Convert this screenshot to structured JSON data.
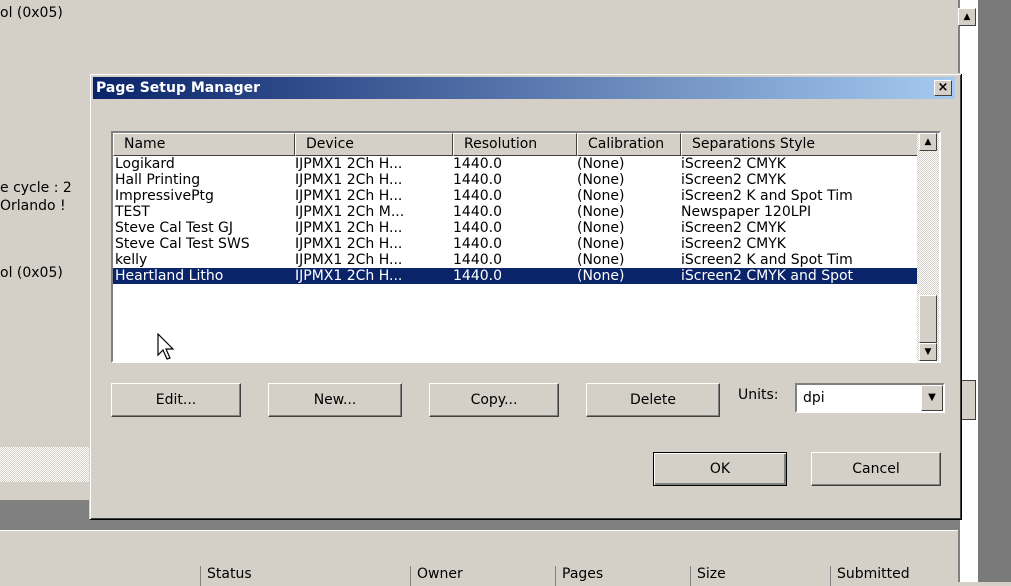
{
  "background": {
    "texts": [
      "ol (0x05)",
      "e cycle : 2",
      " Orlando !",
      "ol (0x05)"
    ],
    "bottom_columns": [
      "Status",
      "Owner",
      "Pages",
      "Size",
      "Submitted"
    ]
  },
  "dialog": {
    "title": "Page Setup Manager",
    "close_glyph": "×",
    "columns": [
      "Name",
      "Device",
      "Resolution",
      "Calibration",
      "Separations Style"
    ],
    "rows": [
      {
        "name": "Logikard",
        "device": "IJPMX1 2Ch H...",
        "resolution": "1440.0",
        "calibration": "(None)",
        "style": "iScreen2 CMYK"
      },
      {
        "name": "Hall Printing",
        "device": "IJPMX1 2Ch H...",
        "resolution": "1440.0",
        "calibration": "(None)",
        "style": "iScreen2 CMYK"
      },
      {
        "name": "ImpressivePtg",
        "device": "IJPMX1 2Ch H...",
        "resolution": "1440.0",
        "calibration": "(None)",
        "style": "iScreen2 K and Spot Tim"
      },
      {
        "name": "TEST",
        "device": "IJPMX1 2Ch M...",
        "resolution": "1440.0",
        "calibration": "(None)",
        "style": "Newspaper 120LPI"
      },
      {
        "name": "Steve Cal Test GJ",
        "device": "IJPMX1 2Ch H...",
        "resolution": "1440.0",
        "calibration": "(None)",
        "style": "iScreen2 CMYK"
      },
      {
        "name": "Steve Cal Test SWS",
        "device": "IJPMX1 2Ch H...",
        "resolution": "1440.0",
        "calibration": "(None)",
        "style": "iScreen2 CMYK"
      },
      {
        "name": "kelly",
        "device": "IJPMX1 2Ch H...",
        "resolution": "1440.0",
        "calibration": "(None)",
        "style": "iScreen2 K and Spot Tim"
      },
      {
        "name": "Heartland Litho",
        "device": "IJPMX1 2Ch H...",
        "resolution": "1440.0",
        "calibration": "(None)",
        "style": "iScreen2 CMYK and Spot"
      }
    ],
    "selected_row_index": 7,
    "buttons": {
      "edit": "Edit...",
      "new": "New...",
      "copy": "Copy...",
      "delete": "Delete",
      "ok": "OK",
      "cancel": "Cancel"
    },
    "units": {
      "label": "Units:",
      "value": "dpi"
    }
  }
}
